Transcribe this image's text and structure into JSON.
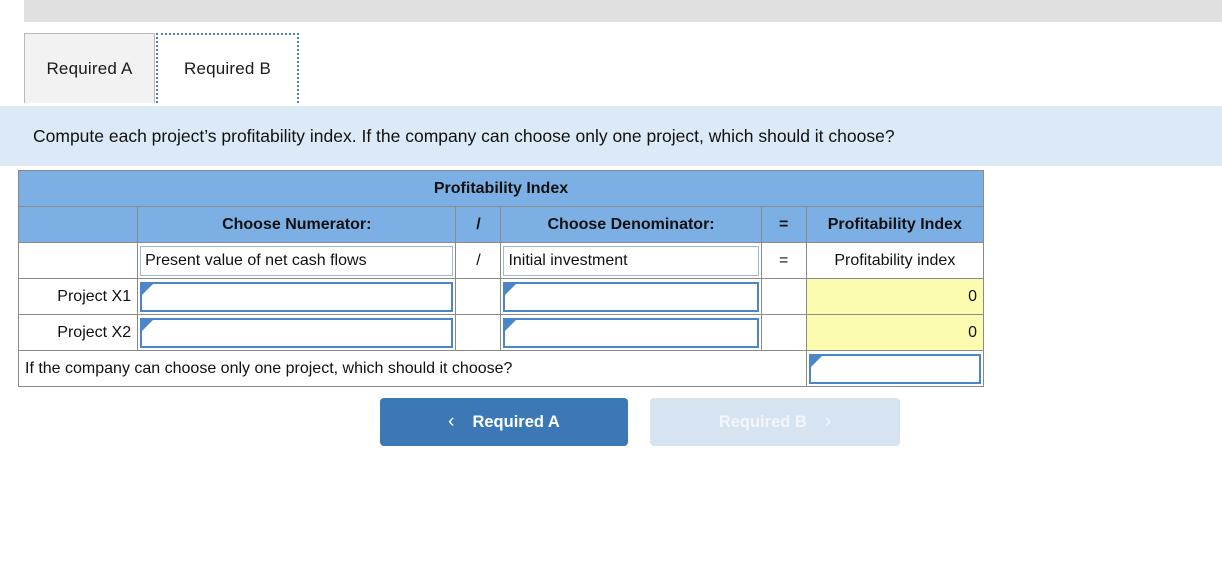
{
  "tabs": [
    {
      "label": "Required A",
      "active": false
    },
    {
      "label": "Required B",
      "active": true
    }
  ],
  "banner": {
    "text": "Compute each project’s profitability index. If the company can choose only one project, which should it choose?"
  },
  "table": {
    "title": "Profitability Index",
    "headers": {
      "blank": "",
      "numerator": "Choose Numerator:",
      "slash": "/",
      "denominator": "Choose Denominator:",
      "equals": "=",
      "result": "Profitability Index"
    },
    "formula_row": {
      "label": "",
      "numerator": "Present value of net cash flows",
      "slash": "/",
      "denominator": "Initial investment",
      "equals": "=",
      "result": "Profitability index"
    },
    "rows": [
      {
        "label": "Project X1",
        "numerator": "",
        "slash": "",
        "denominator": "",
        "equals": "",
        "result": "0"
      },
      {
        "label": "Project X2",
        "numerator": "",
        "slash": "",
        "denominator": "",
        "equals": "",
        "result": "0"
      }
    ],
    "final_question": {
      "text": "If the company can choose only one project, which should it choose?",
      "answer": ""
    }
  },
  "nav": {
    "prev_label": "Required A",
    "next_label": "Required B",
    "prev_icon": "chevron-left-icon",
    "next_icon": "chevron-right-icon",
    "prev_chevron": "‹",
    "next_chevron": "›"
  },
  "colors": {
    "header_blue": "#7CAFE4",
    "banner_blue": "#DCEAF7",
    "answer_yellow": "#FCFCB0",
    "button_blue": "#3B78B5",
    "button_disabled": "#D6E4F2",
    "dropdown_border": "#4A86C8"
  }
}
